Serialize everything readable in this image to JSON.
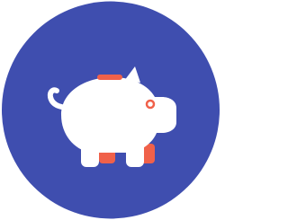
{
  "icon": {
    "name": "piggy-bank-icon",
    "colors": {
      "background_circle": "#3F4EAF",
      "pig_body": "#FFFFFF",
      "accent": "#F0614A"
    }
  }
}
